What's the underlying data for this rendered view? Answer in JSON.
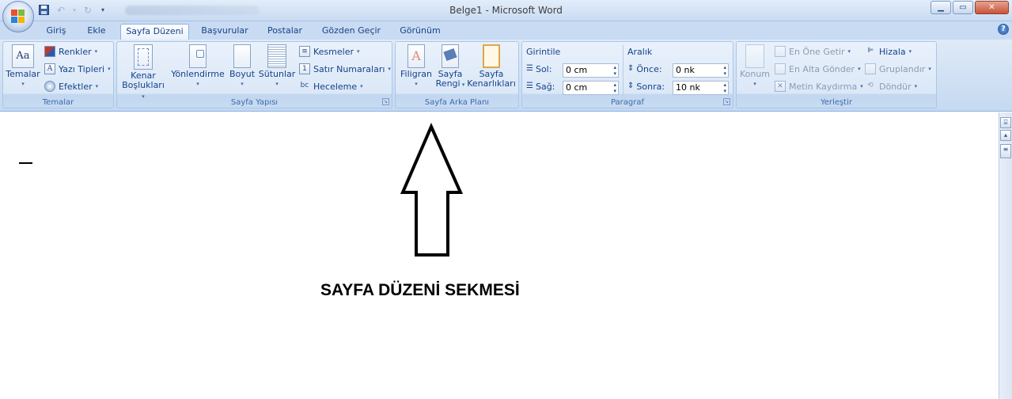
{
  "window": {
    "title": "Belge1 - Microsoft Word",
    "controls": {
      "minimize": "▁",
      "maximize": "▭",
      "close": "✕"
    }
  },
  "quick_access": {
    "save_icon": "save-icon",
    "undo_icon": "undo-icon",
    "redo_icon": "redo-icon",
    "customize_icon": "customize-qat-icon"
  },
  "tabs": [
    {
      "label": "Giriş",
      "active": false
    },
    {
      "label": "Ekle",
      "active": false
    },
    {
      "label": "Sayfa Düzeni",
      "active": true
    },
    {
      "label": "Başvurular",
      "active": false
    },
    {
      "label": "Postalar",
      "active": false
    },
    {
      "label": "Gözden Geçir",
      "active": false
    },
    {
      "label": "Görünüm",
      "active": false
    }
  ],
  "help_label": "?",
  "groups": {
    "temalar": {
      "label": "Temalar",
      "big": {
        "label": "Temalar",
        "icon": "themes-icon",
        "icon_text": "Aa"
      },
      "items": [
        {
          "label": "Renkler",
          "icon": "colors-icon"
        },
        {
          "label": "Yazı Tipleri",
          "icon": "fonts-icon"
        },
        {
          "label": "Efektler",
          "icon": "effects-icon"
        }
      ]
    },
    "sayfa_yapisi": {
      "label": "Sayfa Yapısı",
      "buttons": [
        {
          "line1": "Kenar",
          "line2": "Boşlukları",
          "icon": "margins-icon"
        },
        {
          "line1": "Yönlendirme",
          "line2": "",
          "icon": "orientation-icon"
        },
        {
          "line1": "Boyut",
          "line2": "",
          "icon": "size-icon"
        },
        {
          "line1": "Sütunlar",
          "line2": "",
          "icon": "columns-icon"
        }
      ],
      "items": [
        {
          "label": "Kesmeler",
          "icon": "breaks-icon"
        },
        {
          "label": "Satır Numaraları",
          "icon": "line-numbers-icon"
        },
        {
          "label": "Heceleme",
          "icon": "hyphenation-icon"
        }
      ]
    },
    "sayfa_arka_plani": {
      "label": "Sayfa Arka Planı",
      "buttons": [
        {
          "line1": "Filigran",
          "line2": "",
          "icon": "watermark-icon"
        },
        {
          "line1": "Sayfa",
          "line2": "Rengi",
          "icon": "page-color-icon"
        },
        {
          "line1": "Sayfa",
          "line2": "Kenarlıkları",
          "icon": "page-borders-icon"
        }
      ]
    },
    "paragraf": {
      "label": "Paragraf",
      "girintile": {
        "title": "Girintile",
        "sol_label": "Sol:",
        "sol_value": "0 cm",
        "sag_label": "Sağ:",
        "sag_value": "0 cm"
      },
      "aralik": {
        "title": "Aralık",
        "once_label": "Önce:",
        "once_value": "0 nk",
        "sonra_label": "Sonra:",
        "sonra_value": "10 nk"
      }
    },
    "yerlestir": {
      "label": "Yerleştir",
      "big": {
        "label": "Konum",
        "icon": "position-icon"
      },
      "items": [
        {
          "label": "En Öne Getir",
          "icon": "bring-front-icon"
        },
        {
          "label": "En Alta Gönder",
          "icon": "send-back-icon"
        },
        {
          "label": "Metin Kaydırma",
          "icon": "text-wrap-icon"
        }
      ],
      "items_right": [
        {
          "label": "Hizala",
          "icon": "align-icon"
        },
        {
          "label": "Gruplandır",
          "icon": "group-icon"
        },
        {
          "label": "Döndür",
          "icon": "rotate-icon"
        }
      ]
    }
  },
  "annotation": {
    "caption": "SAYFA DÜZENİ SEKMESİ",
    "arrow_icon": "up-arrow-icon"
  },
  "colors": {
    "ribbon_bg": "#c5d9f1",
    "tab_text": "#15428b",
    "group_label": "#3e6aaa",
    "annotation": "#000000"
  }
}
